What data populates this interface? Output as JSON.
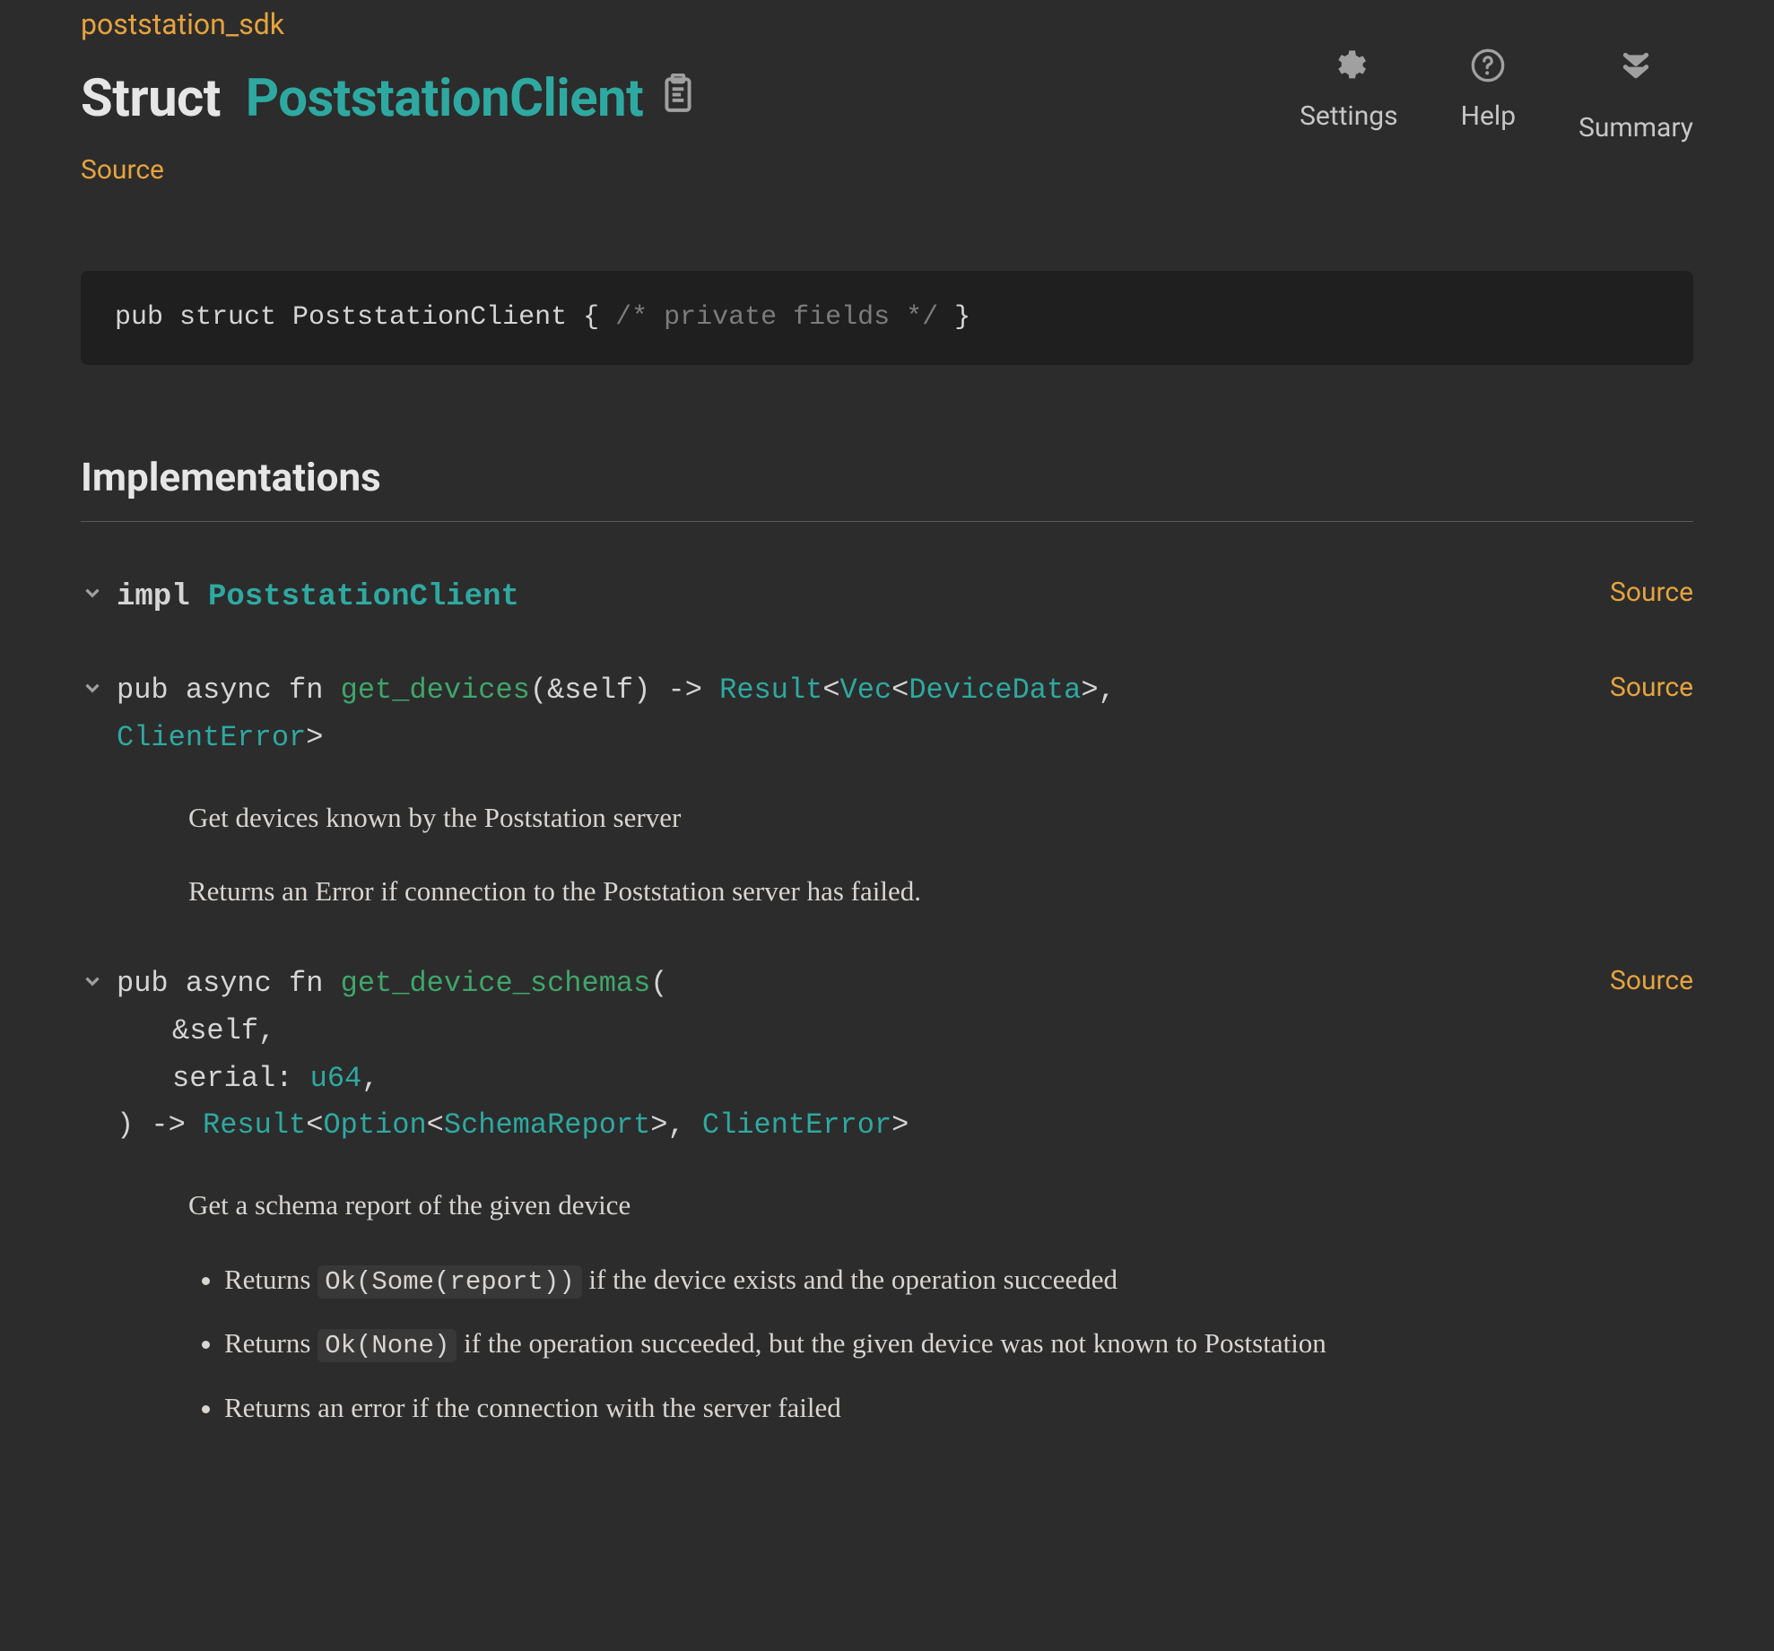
{
  "crate": "poststation_sdk",
  "title_kind": "Struct",
  "title_name": "PoststationClient",
  "source_label": "Source",
  "header_buttons": {
    "settings": "Settings",
    "help": "Help",
    "summary": "Summary"
  },
  "decl": {
    "prefix": "pub struct PoststationClient { ",
    "comment": "/* private fields */",
    "suffix": " }"
  },
  "sections": {
    "implementations": "Implementations"
  },
  "impl": {
    "kw": "impl ",
    "name": "PoststationClient",
    "source": "Source"
  },
  "methods": [
    {
      "source": "Source",
      "sig_prefix": "pub async fn ",
      "name": "get_devices",
      "sig_mid1": "(&self) -> ",
      "ret_result": "Result",
      "lt1": "<",
      "ret_vec": "Vec",
      "lt2": "<",
      "ret_inner": "DeviceData",
      "gt2": ">, ",
      "ret_err": "ClientError",
      "gt1": ">",
      "doc": {
        "p1": "Get devices known by the Poststation server",
        "p2": "Returns an Error if connection to the Poststation server has failed."
      }
    },
    {
      "source": "Source",
      "sig_prefix": "pub async fn ",
      "name": "get_device_schemas",
      "open_paren": "(",
      "arg1": "&self,",
      "arg2a": "serial: ",
      "arg2_type": "u64",
      "arg2b": ",",
      "close_prefix": ") -> ",
      "ret_result": "Result",
      "lt1": "<",
      "ret_option": "Option",
      "lt2": "<",
      "ret_inner": "SchemaReport",
      "gt2": ">, ",
      "ret_err": "ClientError",
      "gt1": ">",
      "doc": {
        "p1": "Get a schema report of the given device",
        "li1a": "Returns ",
        "li1_code": "Ok(Some(report))",
        "li1b": " if the device exists and the operation succeeded",
        "li2a": "Returns ",
        "li2_code": "Ok(None)",
        "li2b": " if the operation succeeded, but the given device was not known to Poststation",
        "li3": "Returns an error if the connection with the server failed"
      }
    }
  ]
}
